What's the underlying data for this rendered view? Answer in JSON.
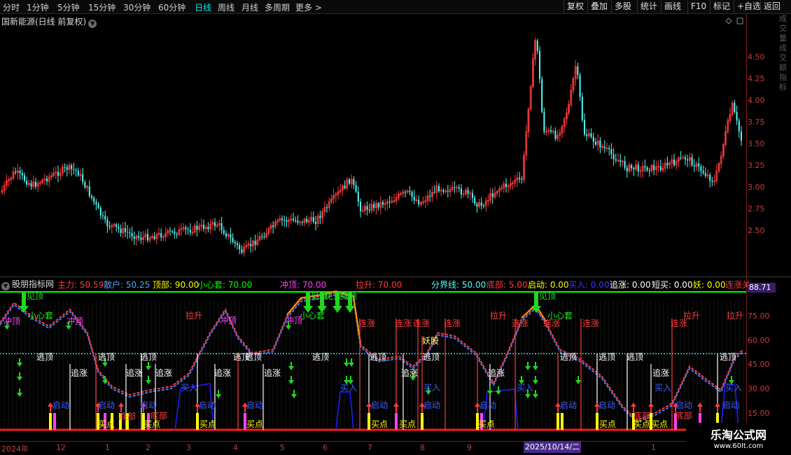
{
  "toolbar": {
    "periods": [
      "分时",
      "1分钟",
      "5分钟",
      "15分钟",
      "30分钟",
      "60分钟",
      "日线",
      "周线",
      "月线",
      "多周期",
      "更多 >"
    ],
    "active_period": "日线",
    "buttons": [
      "复权",
      "叠加",
      "多股",
      "统计",
      "画线",
      "F10",
      "标记",
      "+自选",
      "返回"
    ]
  },
  "main_chart": {
    "title": "国新能源(日线 前复权)",
    "price_ticks": [
      "4.50",
      "4.25",
      "4.00",
      "3.75",
      "3.50",
      "3.25",
      "3.00",
      "2.75",
      "2.50"
    ],
    "up_color": "#ff3c3c",
    "down_color": "#54fcfc"
  },
  "indicator": {
    "name": "股朋指标网",
    "legend": [
      {
        "label": "主力: 50.59",
        "color": "#ff3c3c"
      },
      {
        "label": "散户: 50.25",
        "color": "#54a0ff"
      },
      {
        "label": "顶部: 90.00",
        "color": "#ffff00"
      },
      {
        "label": "小心套: 70.00",
        "color": "#00ff00"
      },
      {
        "label": "冲顶: 70.00",
        "color": "#ff40ff"
      },
      {
        "label": "拉升: 70.00",
        "color": "#ff3c3c"
      },
      {
        "label": "分界线: 50.00",
        "color": "#54fcfc"
      },
      {
        "label": "底部: 5.00",
        "color": "#ff3c3c"
      },
      {
        "label": "启动: 0.00",
        "color": "#ffff00"
      },
      {
        "label": "买入: 0.00",
        "color": "#3c3cff"
      },
      {
        "label": "追涨: 0.00",
        "color": "#ffffff"
      },
      {
        "label": "短买: 0.00",
        "color": "#ffffff"
      },
      {
        "label": "妖: 0.00",
        "color": "#ffff00"
      },
      {
        "label": "连涨关",
        "color": "#ff3c3c"
      }
    ],
    "ticks": [
      "75.00",
      "60.00",
      "45.00",
      "30.00",
      "15.00"
    ],
    "current_value": "88.71",
    "signals": {
      "peak": "见顶",
      "trap": "小心套",
      "rush": "冲顶",
      "rise": "拉升",
      "streak": "连涨",
      "demon": "妖股",
      "escape": "逃顶",
      "chase": "追涨",
      "buy": "买入",
      "start": "启动",
      "buy_point": "买点",
      "bottom": "底部"
    }
  },
  "date_axis": {
    "labels": [
      "2024年",
      "12",
      "1",
      "2",
      "3",
      "4",
      "5",
      "6",
      "7",
      "8",
      "9",
      "1"
    ],
    "cursor_date": "2025/10/14/二"
  },
  "right_strip_text": "成交量成交额指标",
  "watermark": {
    "title": "乐淘公式网",
    "url": "www.60lt.com"
  }
}
